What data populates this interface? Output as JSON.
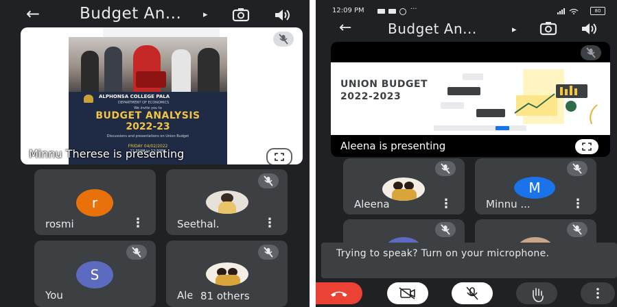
{
  "left": {
    "title": "Budget An...",
    "caret": "▸",
    "presentation": {
      "poster": {
        "college": "ALPHONSA COLLEGE PALA",
        "department": "DEPARTMENT OF ECONOMICS",
        "invite": "We invite you to",
        "heading_line1": "BUDGET ANALYSIS",
        "heading_line2": "2022-23",
        "subtitle": "Discussions and presentations on Union Budget",
        "date": "FRIDAY 04/02/2022",
        "time": "11:30AM to 12:30PM"
      },
      "presenting": "Minnu Therese is presenting"
    },
    "tiles": [
      {
        "name": "rosmi",
        "initial": "r",
        "color": "#e8710a"
      },
      {
        "name": "Seethal."
      },
      {
        "name": "You",
        "initial": "S",
        "color": "#5c6bc0"
      },
      {
        "name": "Ale"
      }
    ],
    "others": "81 others"
  },
  "right": {
    "status": {
      "time": "12:09 PM",
      "dots": "···",
      "battery": "80"
    },
    "title": "Budget An...",
    "caret": "▸",
    "presentation": {
      "slide_title_line1": "UNION BUDGET",
      "slide_title_line2": "2022-2023",
      "presenting": "Aleena is presenting"
    },
    "tiles": [
      {
        "name": "Aleena"
      },
      {
        "name": "Minnu ...",
        "initial": "M",
        "color": "#1a73e8"
      }
    ],
    "toast": "Trying to speak? Turn on your microphone."
  }
}
